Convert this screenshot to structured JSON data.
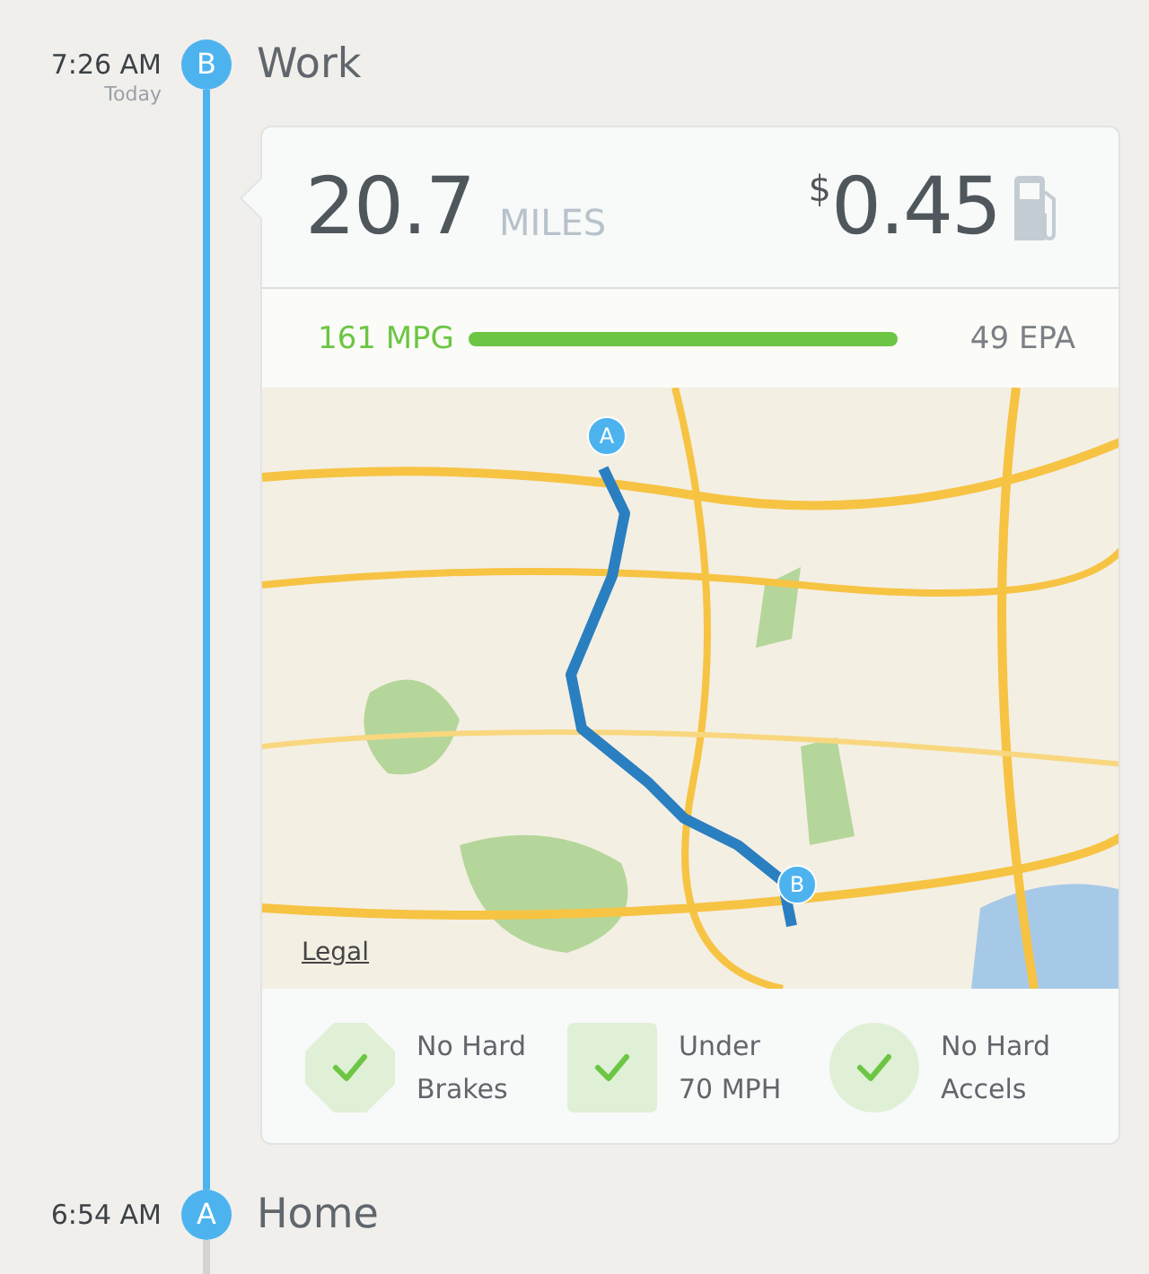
{
  "trip_end": {
    "time": "7:26 AM",
    "day": "Today",
    "marker": "B",
    "place": "Work"
  },
  "card": {
    "distance": "20.7",
    "distance_unit": "MILES",
    "currency": "$",
    "cost": "0.45",
    "mpg": {
      "value": "161 MPG",
      "epa": "49 EPA"
    },
    "map": {
      "kind": "picture",
      "pins": [
        {
          "label": "A"
        },
        {
          "label": "B"
        }
      ],
      "legal": "Legal"
    },
    "badges": [
      {
        "kind": "octagon",
        "checked": true,
        "label": "No Hard\nBrakes"
      },
      {
        "kind": "square",
        "checked": true,
        "label": "Under\n70 MPH"
      },
      {
        "kind": "circle",
        "checked": true,
        "label": "No Hard\nAccels"
      }
    ]
  },
  "trip_start": {
    "time": "6:54 AM",
    "marker": "A",
    "place": "Home"
  }
}
